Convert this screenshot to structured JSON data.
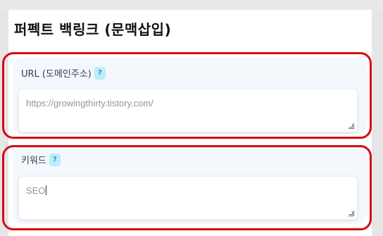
{
  "page": {
    "title": "퍼펙트 백링크 (문맥삽입)"
  },
  "url_field": {
    "label": "URL (도메인주소)",
    "help": "?",
    "placeholder": "https://growingthirty.tistory.com/",
    "value": ""
  },
  "keyword_field": {
    "label": "키워드",
    "help": "?",
    "value": "SEO"
  },
  "colors": {
    "highlight_ring": "#d60a12",
    "help_badge_bg": "#b9eefa",
    "section_bg": "#f4f8fc"
  }
}
